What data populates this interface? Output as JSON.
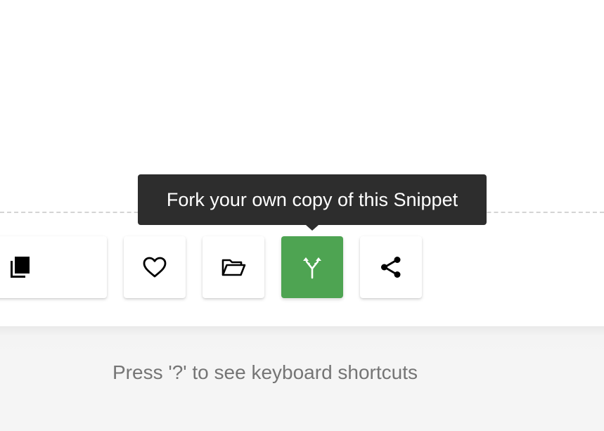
{
  "toolbar": {
    "buttons": [
      {
        "id": "copy",
        "icon": "copy-icon"
      },
      {
        "id": "favorite",
        "icon": "heart-icon"
      },
      {
        "id": "open",
        "icon": "folder-open-icon"
      },
      {
        "id": "fork",
        "icon": "fork-icon",
        "active": true
      },
      {
        "id": "share",
        "icon": "share-icon"
      }
    ]
  },
  "tooltip": {
    "text": "Fork your own copy of this Snippet"
  },
  "footer": {
    "shortcut_hint": "Press '?' to see keyboard shortcuts"
  },
  "colors": {
    "fork_active": "#4ea452",
    "tooltip_bg": "#2d2d2d",
    "hint_text": "#757575"
  }
}
